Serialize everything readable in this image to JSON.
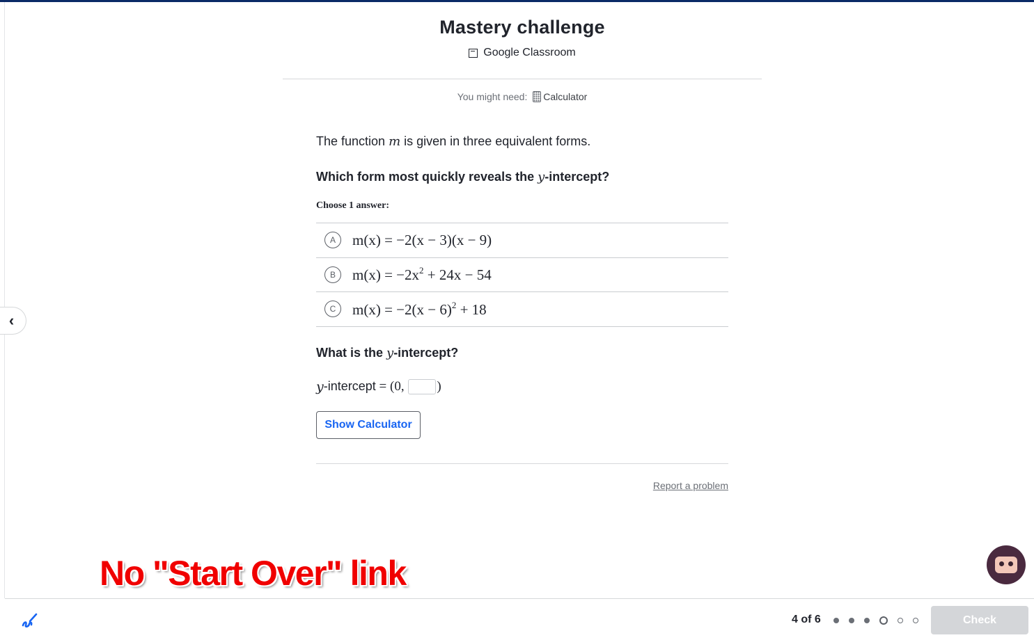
{
  "header": {
    "title": "Mastery challenge",
    "classroom_label": "Google Classroom"
  },
  "tools": {
    "need_prefix": "You might need:",
    "calculator_label": "Calculator"
  },
  "question": {
    "intro_before": "The function ",
    "intro_var": "m",
    "intro_after": " is given in three equivalent forms.",
    "prompt_before": "Which form most quickly reveals the ",
    "prompt_var": "y",
    "prompt_after": "-intercept?",
    "choose_label": "Choose 1 answer:",
    "choices": [
      {
        "letter": "A",
        "expr": "m(x) = −2(x − 3)(x − 9)"
      },
      {
        "letter": "B",
        "expr_pre": "m(x) = −2x",
        "exp": "2",
        "expr_post": " + 24x − 54"
      },
      {
        "letter": "C",
        "expr_pre": "m(x) = −2(x − 6)",
        "exp": "2",
        "expr_post": " + 18"
      }
    ],
    "prompt2_before": "What is the ",
    "prompt2_var": "y",
    "prompt2_after": "-intercept?",
    "answer_var": "y",
    "answer_text": "-intercept",
    "answer_eq": " = (0, ",
    "answer_close": ")",
    "answer_value": "",
    "show_calculator_label": "Show Calculator",
    "report_label": "Report a problem"
  },
  "overlay_caption": "No \"Start Over\" link",
  "footer": {
    "progress_text": "4 of 6",
    "current_index": 4,
    "total": 6,
    "check_label": "Check"
  },
  "colors": {
    "accent_blue": "#1865f2",
    "top_bar": "#0a2a66",
    "overlay_red": "#f00000",
    "check_disabled": "#d4d6d9"
  },
  "icons": [
    "google-classroom-icon",
    "calculator-icon",
    "chevron-left-icon",
    "scratchpad-icon",
    "avatar-icon"
  ]
}
